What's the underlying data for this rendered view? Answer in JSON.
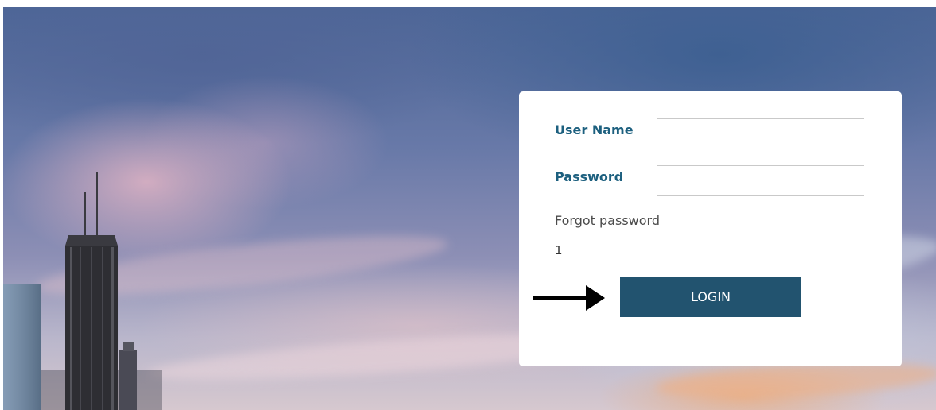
{
  "login_form": {
    "username_label": "User Name",
    "username_value": "",
    "password_label": "Password",
    "password_value": "",
    "forgot_password_label": "Forgot password",
    "code_value": "1",
    "login_label": "LOGIN"
  },
  "icons": {
    "pointer": "right-arrow-icon"
  },
  "colors": {
    "label": "#1d607f",
    "button": "#22536f",
    "card": "#ffffff"
  }
}
